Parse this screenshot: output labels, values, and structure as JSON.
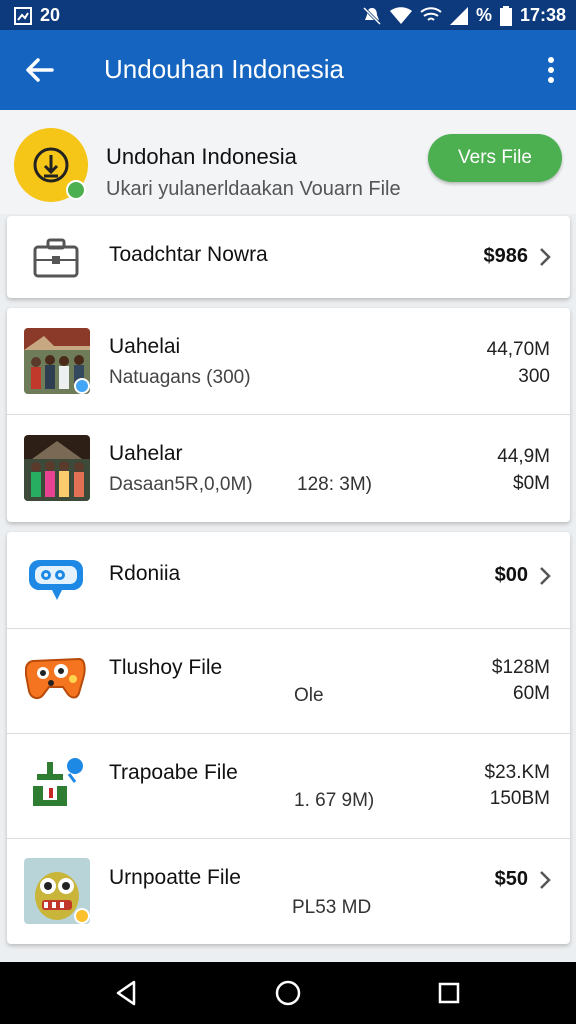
{
  "status_bar": {
    "left_text": "20",
    "battery": "%",
    "time": "17:38"
  },
  "app_bar": {
    "title": "Undouhan Indonesia"
  },
  "header": {
    "title": "Undohan Indonesia",
    "subtitle": "Ukari yulanerldaakan Vouarn File",
    "action_label": "Vers File"
  },
  "featured": {
    "name": "Toadchtar Nowra",
    "price": "$986"
  },
  "photos": [
    {
      "name": "Uahelai",
      "sub": "Natuagans (300)",
      "mid": "",
      "size": "44,70M",
      "count": "300"
    },
    {
      "name": "Uahelar",
      "sub": "Dasaan5R,0,0M)",
      "mid": "128: 3M)",
      "size": "44,9M",
      "count": "$0M"
    }
  ],
  "files": [
    {
      "name": "Rdoniia",
      "price": "$00",
      "has_chevron": true,
      "mid": "",
      "r1": "",
      "r2": ""
    },
    {
      "name": "Tlushoy File",
      "price": "",
      "has_chevron": false,
      "mid": "Ole",
      "r1": "$128M",
      "r2": "60M"
    },
    {
      "name": "Trapoabe File",
      "price": "",
      "has_chevron": false,
      "mid": "1. 67 9M)",
      "r1": "$23.KM",
      "r2": "150BM"
    },
    {
      "name": "Urnpoatte File",
      "price": "$50",
      "has_chevron": true,
      "mid": "PL53 MD",
      "r1": "",
      "r2": ""
    }
  ],
  "colors": {
    "status_bar": "#0c3a7d",
    "app_bar": "#1565c0",
    "accent_green": "#4caf50",
    "badge_yellow": "#f5c518"
  },
  "icons": {
    "back": "arrow-left-icon",
    "more": "more-vert-icon",
    "download": "download-icon",
    "briefcase": "briefcase-icon",
    "chevron": "chevron-right-icon"
  }
}
